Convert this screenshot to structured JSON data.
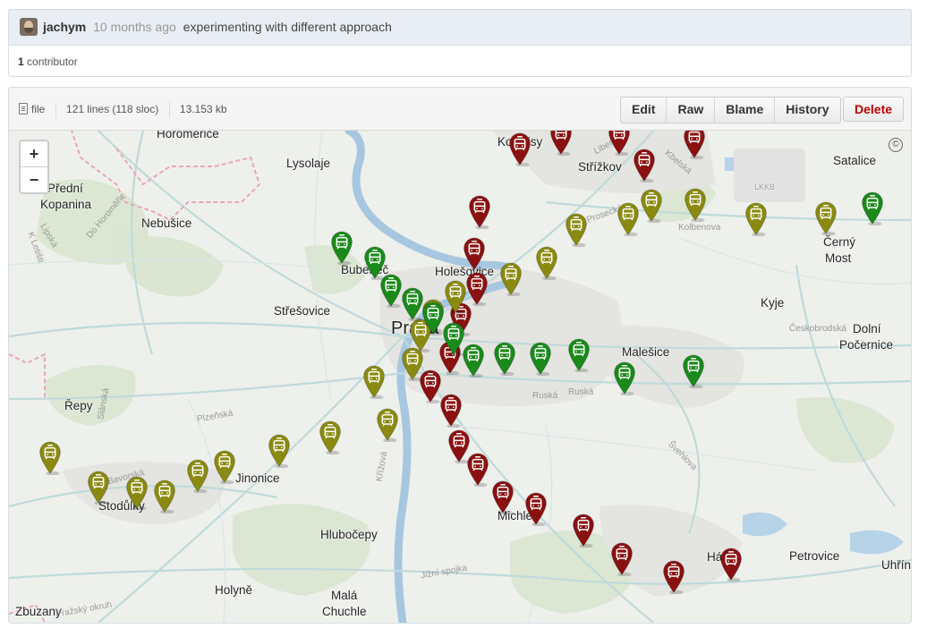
{
  "commit": {
    "author": "jachym",
    "ago": "10 months ago",
    "message": "experimenting with different approach"
  },
  "contributors": {
    "count": "1",
    "label": "contributor"
  },
  "file": {
    "type_label": "file",
    "lines": "121 lines (118 sloc)",
    "size": "13.153 kb"
  },
  "actions": {
    "edit": "Edit",
    "raw": "Raw",
    "blame": "Blame",
    "history": "History",
    "delete": "Delete"
  },
  "map": {
    "zoom_in": "+",
    "zoom_out": "−",
    "copyright": "©",
    "places": [
      {
        "label": "Horomerice"
      },
      {
        "label": "Lysolaje"
      },
      {
        "label": "Kobylisy"
      },
      {
        "label": "Střížkov"
      },
      {
        "label": "Satalice"
      },
      {
        "label": "Přední"
      },
      {
        "label": "Kopanina"
      },
      {
        "label": "Nebušice"
      },
      {
        "label": "Bubeneč"
      },
      {
        "label": "Holešovice"
      },
      {
        "label": "Černý"
      },
      {
        "label": "Most"
      },
      {
        "label": "Střešovice"
      },
      {
        "label": "Kyje"
      },
      {
        "label": "Praha"
      },
      {
        "label": "Dolní"
      },
      {
        "label": "Počernice"
      },
      {
        "label": "Malešice"
      },
      {
        "label": "Řepy"
      },
      {
        "label": "Jinonice"
      },
      {
        "label": "Stodůlky"
      },
      {
        "label": "Hlubočepy"
      },
      {
        "label": "Michle"
      },
      {
        "label": "Petrovice"
      },
      {
        "label": "Háje"
      },
      {
        "label": "Uhříněves"
      },
      {
        "label": "Holyně"
      },
      {
        "label": "Malá"
      },
      {
        "label": "Chuchle"
      },
      {
        "label": "Zbuzany"
      },
      {
        "label": "LKKB"
      }
    ],
    "streets": [
      {
        "label": "Do Horoměřic"
      },
      {
        "label": "K Letišti"
      },
      {
        "label": "Lipská"
      },
      {
        "label": "Prosecká"
      },
      {
        "label": "Kbelská"
      },
      {
        "label": "Kolbenova"
      },
      {
        "label": "Českobrodská"
      },
      {
        "label": "Ruská"
      },
      {
        "label": "Ruská"
      },
      {
        "label": "Plzeňská"
      },
      {
        "label": "Slánská"
      },
      {
        "label": "Bavorská"
      },
      {
        "label": "Křížová"
      },
      {
        "label": "Švehlova"
      },
      {
        "label": "Jižní spojka"
      },
      {
        "label": "Pražský okruh"
      },
      {
        "label": "Liberecká"
      }
    ],
    "marker_colors": {
      "red": "#8b1010",
      "olive": "#8a8a10",
      "green": "#1a8a1a"
    },
    "markers": [
      {
        "color": "red",
        "icon": "tram-icon"
      },
      {
        "color": "red",
        "icon": "tram-icon"
      },
      {
        "color": "red",
        "icon": "tram-icon"
      },
      {
        "color": "red",
        "icon": "tram-icon"
      },
      {
        "color": "red",
        "icon": "tram-icon"
      },
      {
        "color": "red",
        "icon": "tram-icon"
      },
      {
        "color": "red",
        "icon": "tram-icon"
      },
      {
        "color": "red",
        "icon": "tram-icon"
      },
      {
        "color": "red",
        "icon": "tram-icon"
      },
      {
        "color": "red",
        "icon": "tram-icon"
      },
      {
        "color": "red",
        "icon": "tram-icon"
      },
      {
        "color": "red",
        "icon": "tram-icon"
      },
      {
        "color": "red",
        "icon": "tram-icon"
      },
      {
        "color": "red",
        "icon": "tram-icon"
      },
      {
        "color": "red",
        "icon": "tram-icon"
      },
      {
        "color": "red",
        "icon": "tram-icon"
      },
      {
        "color": "red",
        "icon": "tram-icon"
      },
      {
        "color": "red",
        "icon": "tram-icon"
      },
      {
        "color": "red",
        "icon": "tram-icon"
      },
      {
        "color": "red",
        "icon": "tram-icon"
      },
      {
        "color": "olive",
        "icon": "tram-icon"
      },
      {
        "color": "olive",
        "icon": "tram-icon"
      },
      {
        "color": "olive",
        "icon": "tram-icon"
      },
      {
        "color": "olive",
        "icon": "tram-icon"
      },
      {
        "color": "olive",
        "icon": "tram-icon"
      },
      {
        "color": "olive",
        "icon": "tram-icon"
      },
      {
        "color": "olive",
        "icon": "tram-icon"
      },
      {
        "color": "olive",
        "icon": "tram-icon"
      },
      {
        "color": "olive",
        "icon": "tram-icon"
      },
      {
        "color": "olive",
        "icon": "tram-icon"
      },
      {
        "color": "olive",
        "icon": "tram-icon"
      },
      {
        "color": "olive",
        "icon": "tram-icon"
      },
      {
        "color": "olive",
        "icon": "tram-icon"
      },
      {
        "color": "olive",
        "icon": "tram-icon"
      },
      {
        "color": "olive",
        "icon": "tram-icon"
      },
      {
        "color": "olive",
        "icon": "tram-icon"
      },
      {
        "color": "olive",
        "icon": "tram-icon"
      },
      {
        "color": "olive",
        "icon": "tram-icon"
      },
      {
        "color": "olive",
        "icon": "tram-icon"
      },
      {
        "color": "olive",
        "icon": "tram-icon"
      },
      {
        "color": "olive",
        "icon": "tram-icon"
      },
      {
        "color": "olive",
        "icon": "tram-icon"
      },
      {
        "color": "green",
        "icon": "tram-icon"
      },
      {
        "color": "green",
        "icon": "tram-icon"
      },
      {
        "color": "green",
        "icon": "tram-icon"
      },
      {
        "color": "green",
        "icon": "tram-icon"
      },
      {
        "color": "green",
        "icon": "tram-icon"
      },
      {
        "color": "green",
        "icon": "tram-icon"
      },
      {
        "color": "green",
        "icon": "tram-icon"
      },
      {
        "color": "green",
        "icon": "tram-icon"
      },
      {
        "color": "green",
        "icon": "tram-icon"
      },
      {
        "color": "green",
        "icon": "tram-icon"
      },
      {
        "color": "green",
        "icon": "tram-icon"
      },
      {
        "color": "green",
        "icon": "tram-icon"
      },
      {
        "color": "green",
        "icon": "tram-icon"
      }
    ]
  }
}
